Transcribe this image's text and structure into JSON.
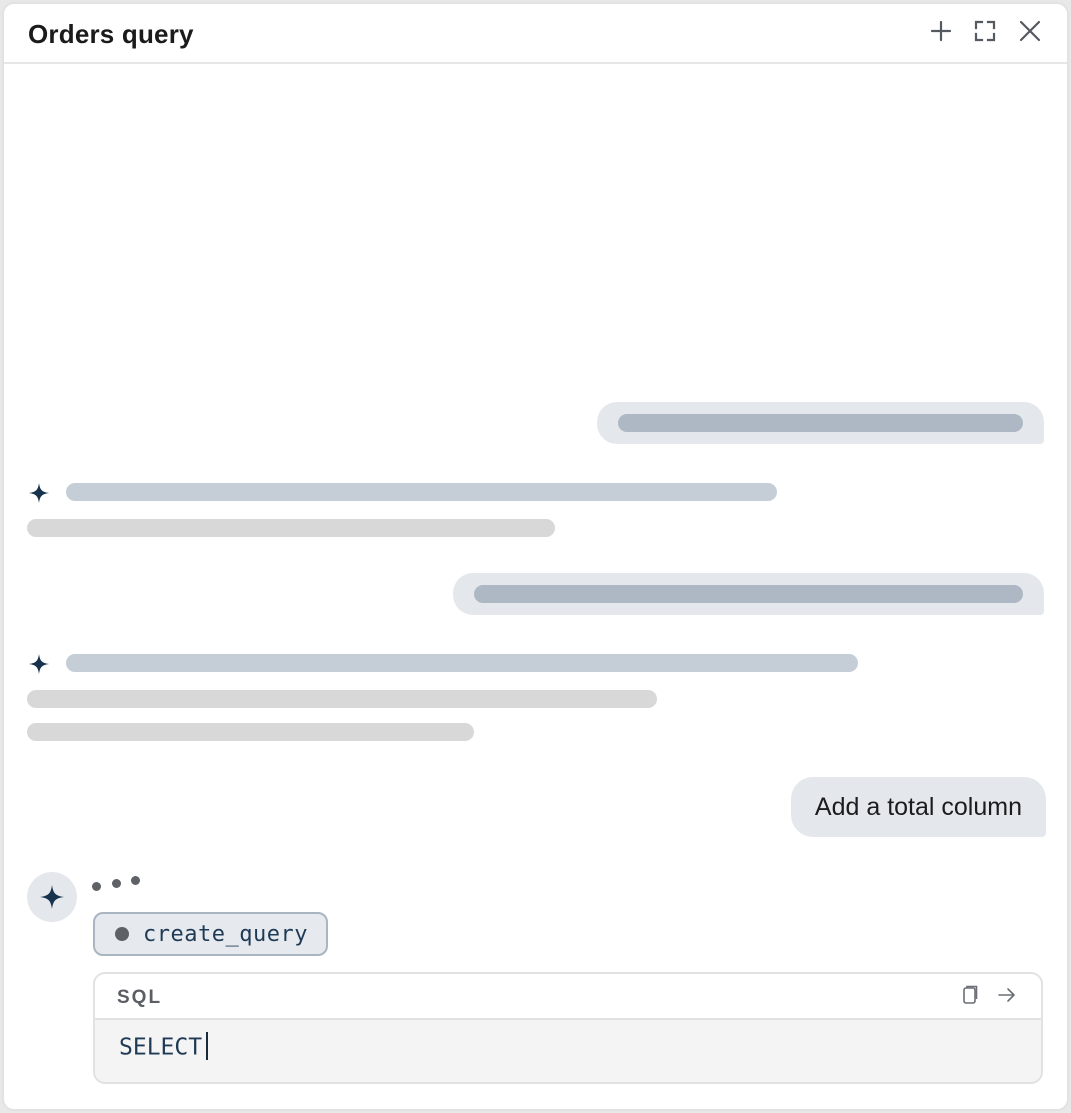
{
  "window": {
    "title": "Orders query"
  },
  "header": {
    "icons": [
      "plus-icon",
      "expand-icon",
      "close-icon"
    ]
  },
  "messages": {
    "latest_user_message": "Add a total column"
  },
  "assistant": {
    "status": "typing",
    "tool_call": {
      "name": "create_query"
    },
    "code_block": {
      "language": "SQL",
      "content": "SELECT",
      "icons": [
        "copy-icon",
        "arrow-right-icon"
      ]
    }
  },
  "colors": {
    "accent": "#17324d",
    "user_bubble": "#e4e8ec",
    "skeleton_user": "#adb8c4",
    "skeleton_ai_head": "#c5ced7",
    "skeleton_ai_body": "#d8d8d8"
  }
}
